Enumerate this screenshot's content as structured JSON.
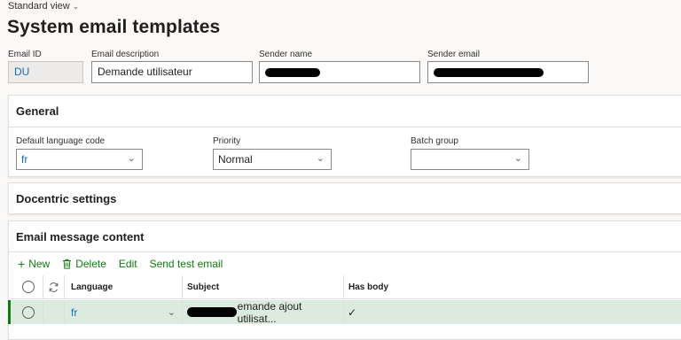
{
  "view_selector": {
    "label": "Standard view",
    "chevron_icon": "chevron-down"
  },
  "page_title": "System email templates",
  "header_fields": {
    "email_id": {
      "label": "Email ID",
      "value": "DU"
    },
    "email_description": {
      "label": "Email description",
      "value": "Demande utilisateur"
    },
    "sender_name": {
      "label": "Sender name",
      "value": ""
    },
    "sender_email": {
      "label": "Sender email",
      "value": ""
    }
  },
  "general": {
    "title": "General",
    "default_language": {
      "label": "Default language code",
      "value": "fr"
    },
    "priority": {
      "label": "Priority",
      "value": "Normal"
    },
    "batch_group": {
      "label": "Batch group",
      "value": ""
    }
  },
  "docentric": {
    "title": "Docentric settings"
  },
  "email_content": {
    "title": "Email message content",
    "toolbar": {
      "new_label": "New",
      "delete_label": "Delete",
      "edit_label": "Edit",
      "send_test_label": "Send test email"
    },
    "columns": {
      "language": "Language",
      "subject": "Subject",
      "has_body": "Has body"
    },
    "rows": [
      {
        "language": "fr",
        "subject": "emande ajout utilisat...",
        "has_body": "✓"
      }
    ]
  },
  "colors": {
    "accent_green": "#107c10",
    "selected_row": "#dcebe0",
    "link_blue": "#0f6cbd"
  }
}
